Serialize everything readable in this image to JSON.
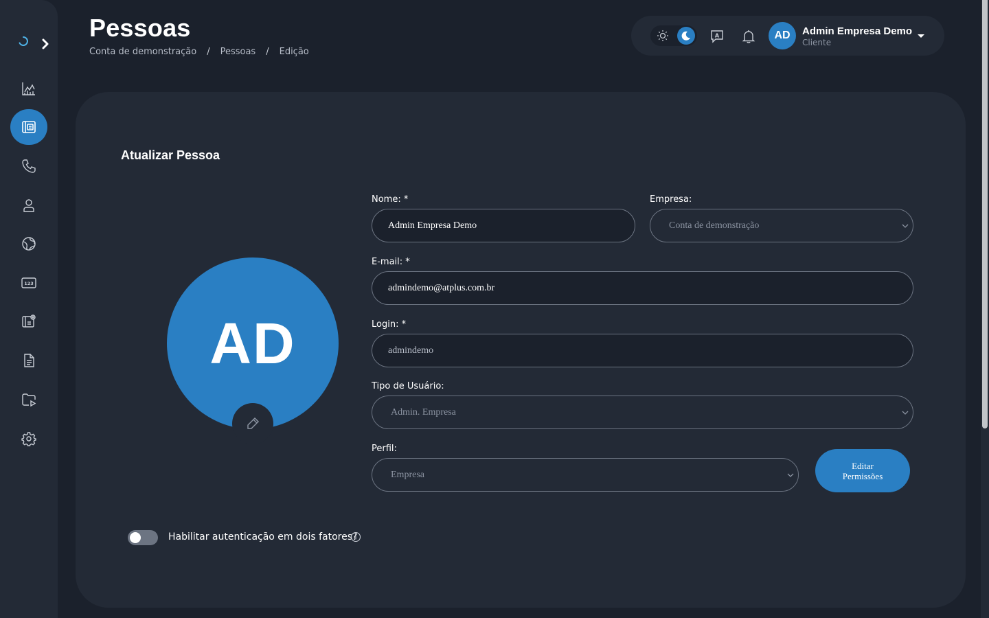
{
  "header": {
    "title": "Pessoas",
    "breadcrumb": [
      "Conta de demonstração",
      "Pessoas",
      "Edição"
    ],
    "breadcrumb_separator": "/"
  },
  "user": {
    "initials": "AD",
    "name": "Admin Empresa Demo",
    "role": "Cliente"
  },
  "sidebar": {
    "items": [
      {
        "icon": "chart-icon"
      },
      {
        "icon": "contacts-icon",
        "active": true
      },
      {
        "icon": "phone-icon"
      },
      {
        "icon": "user-icon"
      },
      {
        "icon": "globe-icon"
      },
      {
        "icon": "numbers-icon"
      },
      {
        "icon": "contact-settings-icon"
      },
      {
        "icon": "document-icon"
      },
      {
        "icon": "folder-play-icon"
      },
      {
        "icon": "gear-icon"
      }
    ]
  },
  "form": {
    "title": "Atualizar Pessoa",
    "avatar_initials": "AD",
    "nome_label": "Nome: *",
    "nome_value": "Admin Empresa Demo",
    "empresa_label": "Empresa:",
    "empresa_value": "Conta de demonstração",
    "email_label": "E-mail: *",
    "email_value": "admindemo@atplus.com.br",
    "login_label": "Login: *",
    "login_value": "admindemo",
    "tipo_label": "Tipo de Usuário:",
    "tipo_value": "Admin. Empresa",
    "perfil_label": "Perfil:",
    "perfil_value": "Empresa",
    "edit_permissions_label": "Editar Permissões",
    "twofa_label": "Habilitar autenticação em dois fatores?",
    "twofa_enabled": false
  },
  "colors": {
    "accent": "#2a7fc3",
    "background": "#1b212c",
    "surface": "#232a36"
  }
}
